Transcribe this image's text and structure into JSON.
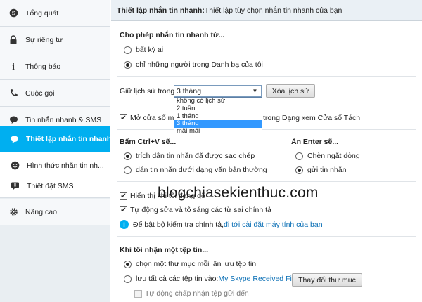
{
  "sidebar": {
    "items": [
      {
        "label": "Tổng quát",
        "icon": "skype-icon"
      },
      {
        "label": "Sự riêng tư",
        "icon": "lock-icon"
      },
      {
        "label": "Thông báo",
        "icon": "info-icon"
      },
      {
        "label": "Cuộc gọi",
        "icon": "phone-icon"
      },
      {
        "label": "Tin nhắn nhanh & SMS",
        "icon": "chat-icon"
      },
      {
        "label": "Thiết lập nhắn tin nhanh",
        "icon": "chat-bubble-icon"
      },
      {
        "label": "Hình thức nhắn tin nh...",
        "icon": "smiley-icon"
      },
      {
        "label": "Thiết đặt SMS",
        "icon": "sms-icon"
      },
      {
        "label": "Nâng cao",
        "icon": "gear-icon"
      }
    ],
    "active_index": 5
  },
  "header": {
    "title": "Thiết lập nhắn tin nhanh:",
    "subtitle": " Thiết lập tùy chọn nhắn tin nhanh của bạn"
  },
  "allow": {
    "title": "Cho phép nhắn tin nhanh từ...",
    "option_anyone": "bất kỳ ai",
    "option_contacts": "chỉ những người trong Danh bạ của tôi",
    "selected": "contacts"
  },
  "history": {
    "label": "Giữ lịch sử trong",
    "selected_value": "3 tháng",
    "clear_button": "Xóa lịch sử",
    "options": [
      "không có lịch sử",
      "2 tuần",
      "1 tháng",
      "3 tháng",
      "mãi mãi"
    ],
    "highlighted_index": 3
  },
  "open_window": {
    "label_prefix": "Mở cửa sổ mới k",
    "label_suffix": "trong Dạng xem Cửa sổ Tách",
    "checked": true
  },
  "paste": {
    "title": "Bấm Ctrl+V sẽ...",
    "option_quote": "trích dẫn tin nhắn đã được sao chép",
    "option_plain": "dán tin nhắn dưới dạng văn bản thường"
  },
  "enter": {
    "title": "Ấn Enter sẽ...",
    "option_newline": "Chèn ngắt dòng",
    "option_send": "gửi tin nhắn"
  },
  "typing": {
    "show_typing": "Hiển thị khi tôi đang gõ",
    "autocorrect": "Tự động sửa và tô sáng các từ sai chính tả"
  },
  "spellcheck": {
    "text": "Để bật bộ kiểm tra chính tả, ",
    "link": "đi tới cài đặt máy tính của bạn"
  },
  "file": {
    "title": "Khi tôi nhận một tệp tin...",
    "option_choose": "chọn một thư mục mỗi lần lưu tệp tin",
    "option_save_prefix": "lưu tất cả các tệp tin vào: ",
    "folder_link": "My Skype Received Files",
    "change_button": "Thay đổi thư mục",
    "auto_accept": "Tự động chấp nhận tệp gửi đến"
  },
  "watermark": "blogchiasekienthuc.com",
  "colors": {
    "accent": "#00aff0",
    "link": "#0a6fb5",
    "selection": "#3399ff"
  }
}
